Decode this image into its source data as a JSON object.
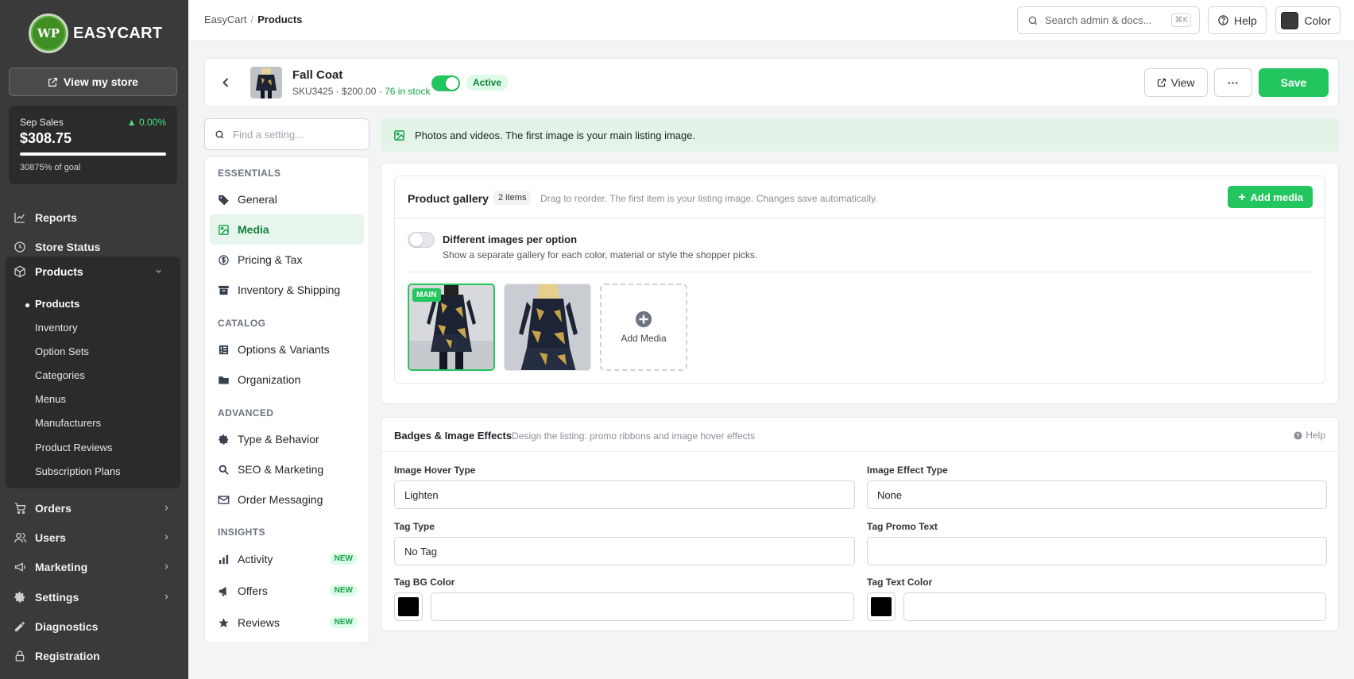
{
  "brand": {
    "logo_text": "WP",
    "name": "EASYCART"
  },
  "sidebar": {
    "view_store": "View my store",
    "sales": {
      "label": "Sep Sales",
      "delta": "▲ 0.00%",
      "value": "$308.75",
      "goal_text": "30875% of goal",
      "progress_fraction": 1.0
    },
    "nav": [
      {
        "label": "Reports",
        "icon": "chart-line-icon"
      },
      {
        "label": "Store Status",
        "icon": "clock-icon"
      },
      {
        "label": "Products",
        "icon": "box-icon",
        "expanded": true
      },
      {
        "label": "Orders",
        "icon": "cart-icon"
      },
      {
        "label": "Users",
        "icon": "users-icon"
      },
      {
        "label": "Marketing",
        "icon": "megaphone-icon"
      },
      {
        "label": "Settings",
        "icon": "gear-icon"
      },
      {
        "label": "Diagnostics",
        "icon": "pencil-icon"
      },
      {
        "label": "Registration",
        "icon": "lock-icon"
      }
    ],
    "products_sub": [
      "Products",
      "Inventory",
      "Option Sets",
      "Categories",
      "Menus",
      "Manufacturers",
      "Product Reviews",
      "Subscription Plans"
    ]
  },
  "topbar": {
    "breadcrumb": [
      "EasyCart",
      "Products"
    ],
    "search_placeholder": "Search admin & docs...",
    "search_shortcut": "⌘K",
    "help": "Help",
    "color": "Color"
  },
  "product": {
    "title": "Fall Coat",
    "meta": "SKU3425 · $200.00 · ",
    "stock": "76 in stock",
    "status": "Active",
    "active": true,
    "view_label": "View",
    "more_label": "···",
    "save_label": "Save"
  },
  "settings_nav": {
    "search_placeholder": "Find a setting...",
    "sections": [
      {
        "title": "ESSENTIALS",
        "items": [
          {
            "label": "General",
            "icon": "tag-icon"
          },
          {
            "label": "Media",
            "icon": "image-icon",
            "active": true
          },
          {
            "label": "Pricing & Tax",
            "icon": "dollar-icon"
          },
          {
            "label": "Inventory & Shipping",
            "icon": "archive-icon"
          }
        ]
      },
      {
        "title": "CATALOG",
        "items": [
          {
            "label": "Options & Variants",
            "icon": "options-icon"
          },
          {
            "label": "Organization",
            "icon": "folder-icon"
          }
        ]
      },
      {
        "title": "ADVANCED",
        "items": [
          {
            "label": "Type & Behavior",
            "icon": "gear-icon"
          },
          {
            "label": "SEO & Marketing",
            "icon": "search-icon"
          },
          {
            "label": "Order Messaging",
            "icon": "mail-icon"
          }
        ]
      },
      {
        "title": "INSIGHTS",
        "items": [
          {
            "label": "Activity",
            "icon": "bar-chart-icon",
            "tag": "NEW"
          },
          {
            "label": "Offers",
            "icon": "megaphone-icon",
            "tag": "NEW"
          },
          {
            "label": "Reviews",
            "icon": "star-icon",
            "tag": "NEW"
          }
        ]
      }
    ]
  },
  "media": {
    "info": "Photos and videos. The first image is your main listing image.",
    "gallery_title": "Product gallery",
    "count": "2 items",
    "hint": "Drag to reorder. The first item is your listing image. Changes save automatically.",
    "add_media_button": "Add media",
    "option_label": "Different images per option",
    "option_sub": "Show a separate gallery for each color, material or style the shopper picks.",
    "option_enabled": false,
    "main_badge": "MAIN",
    "add_tile_label": "Add Media"
  },
  "badges": {
    "title": "Badges & Image Effects",
    "subtitle": "Design the listing: promo ribbons and image hover effects",
    "help": "Help",
    "fields": {
      "hover_type_label": "Image Hover Type",
      "hover_type_value": "Lighten",
      "effect_type_label": "Image Effect Type",
      "effect_type_value": "None",
      "tag_type_label": "Tag Type",
      "tag_type_value": "No Tag",
      "promo_text_label": "Tag Promo Text",
      "promo_text_value": "",
      "bg_color_label": "Tag BG Color",
      "bg_color": "#000000",
      "text_color_label": "Tag Text Color",
      "text_color": "#000000"
    }
  },
  "colors": {
    "accent": "#22c55e",
    "sidebar_bg": "#3a3a3a"
  }
}
